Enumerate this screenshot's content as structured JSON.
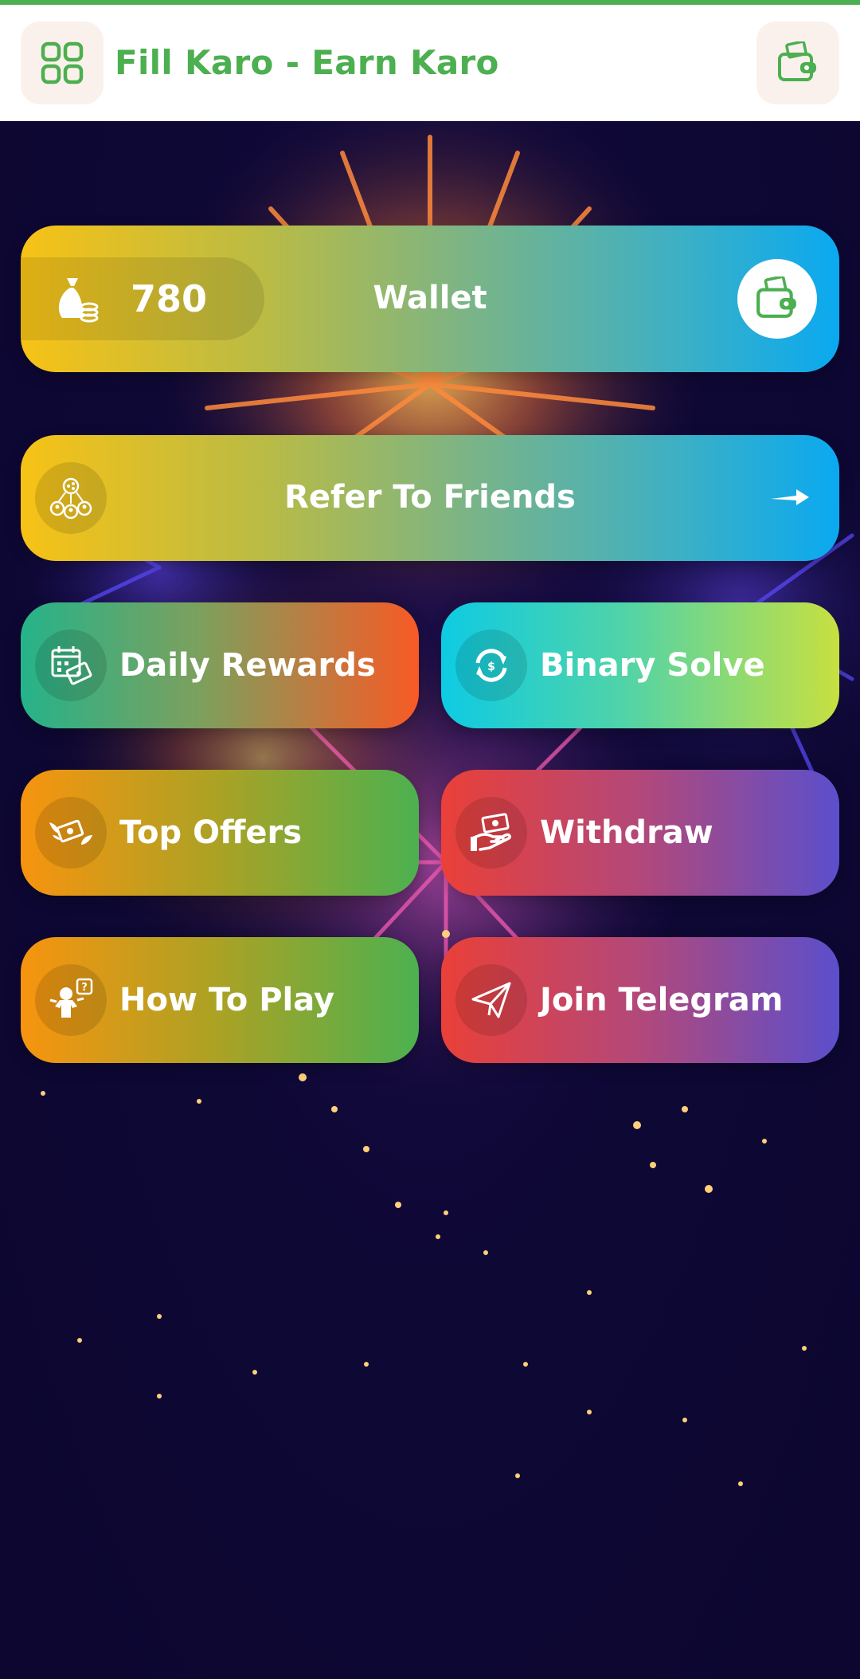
{
  "app": {
    "title": "Fill Karo - Earn Karo"
  },
  "header": {
    "menu_icon": "grid-icon",
    "wallet_icon": "wallet-icon",
    "accent": "#4caf50"
  },
  "wallet": {
    "coins": "780",
    "label": "Wallet",
    "coin_icon": "money-bag-icon",
    "button_icon": "wallet-icon"
  },
  "refer": {
    "label": "Refer To Friends",
    "icon": "share-users-icon",
    "arrow_icon": "arrow-right-icon"
  },
  "tiles": {
    "daily_rewards": {
      "label": "Daily Rewards",
      "icon": "calendar-money-icon"
    },
    "binary_solve": {
      "label": "Binary Solve",
      "icon": "refresh-icon"
    },
    "top_offers": {
      "label": "Top Offers",
      "icon": "flying-money-icon"
    },
    "withdraw": {
      "label": "Withdraw",
      "icon": "cash-hand-icon"
    },
    "how_to_play": {
      "label": "How To Play",
      "icon": "question-person-icon"
    },
    "join_telegram": {
      "label": "Join Telegram",
      "icon": "paper-plane-icon"
    }
  }
}
